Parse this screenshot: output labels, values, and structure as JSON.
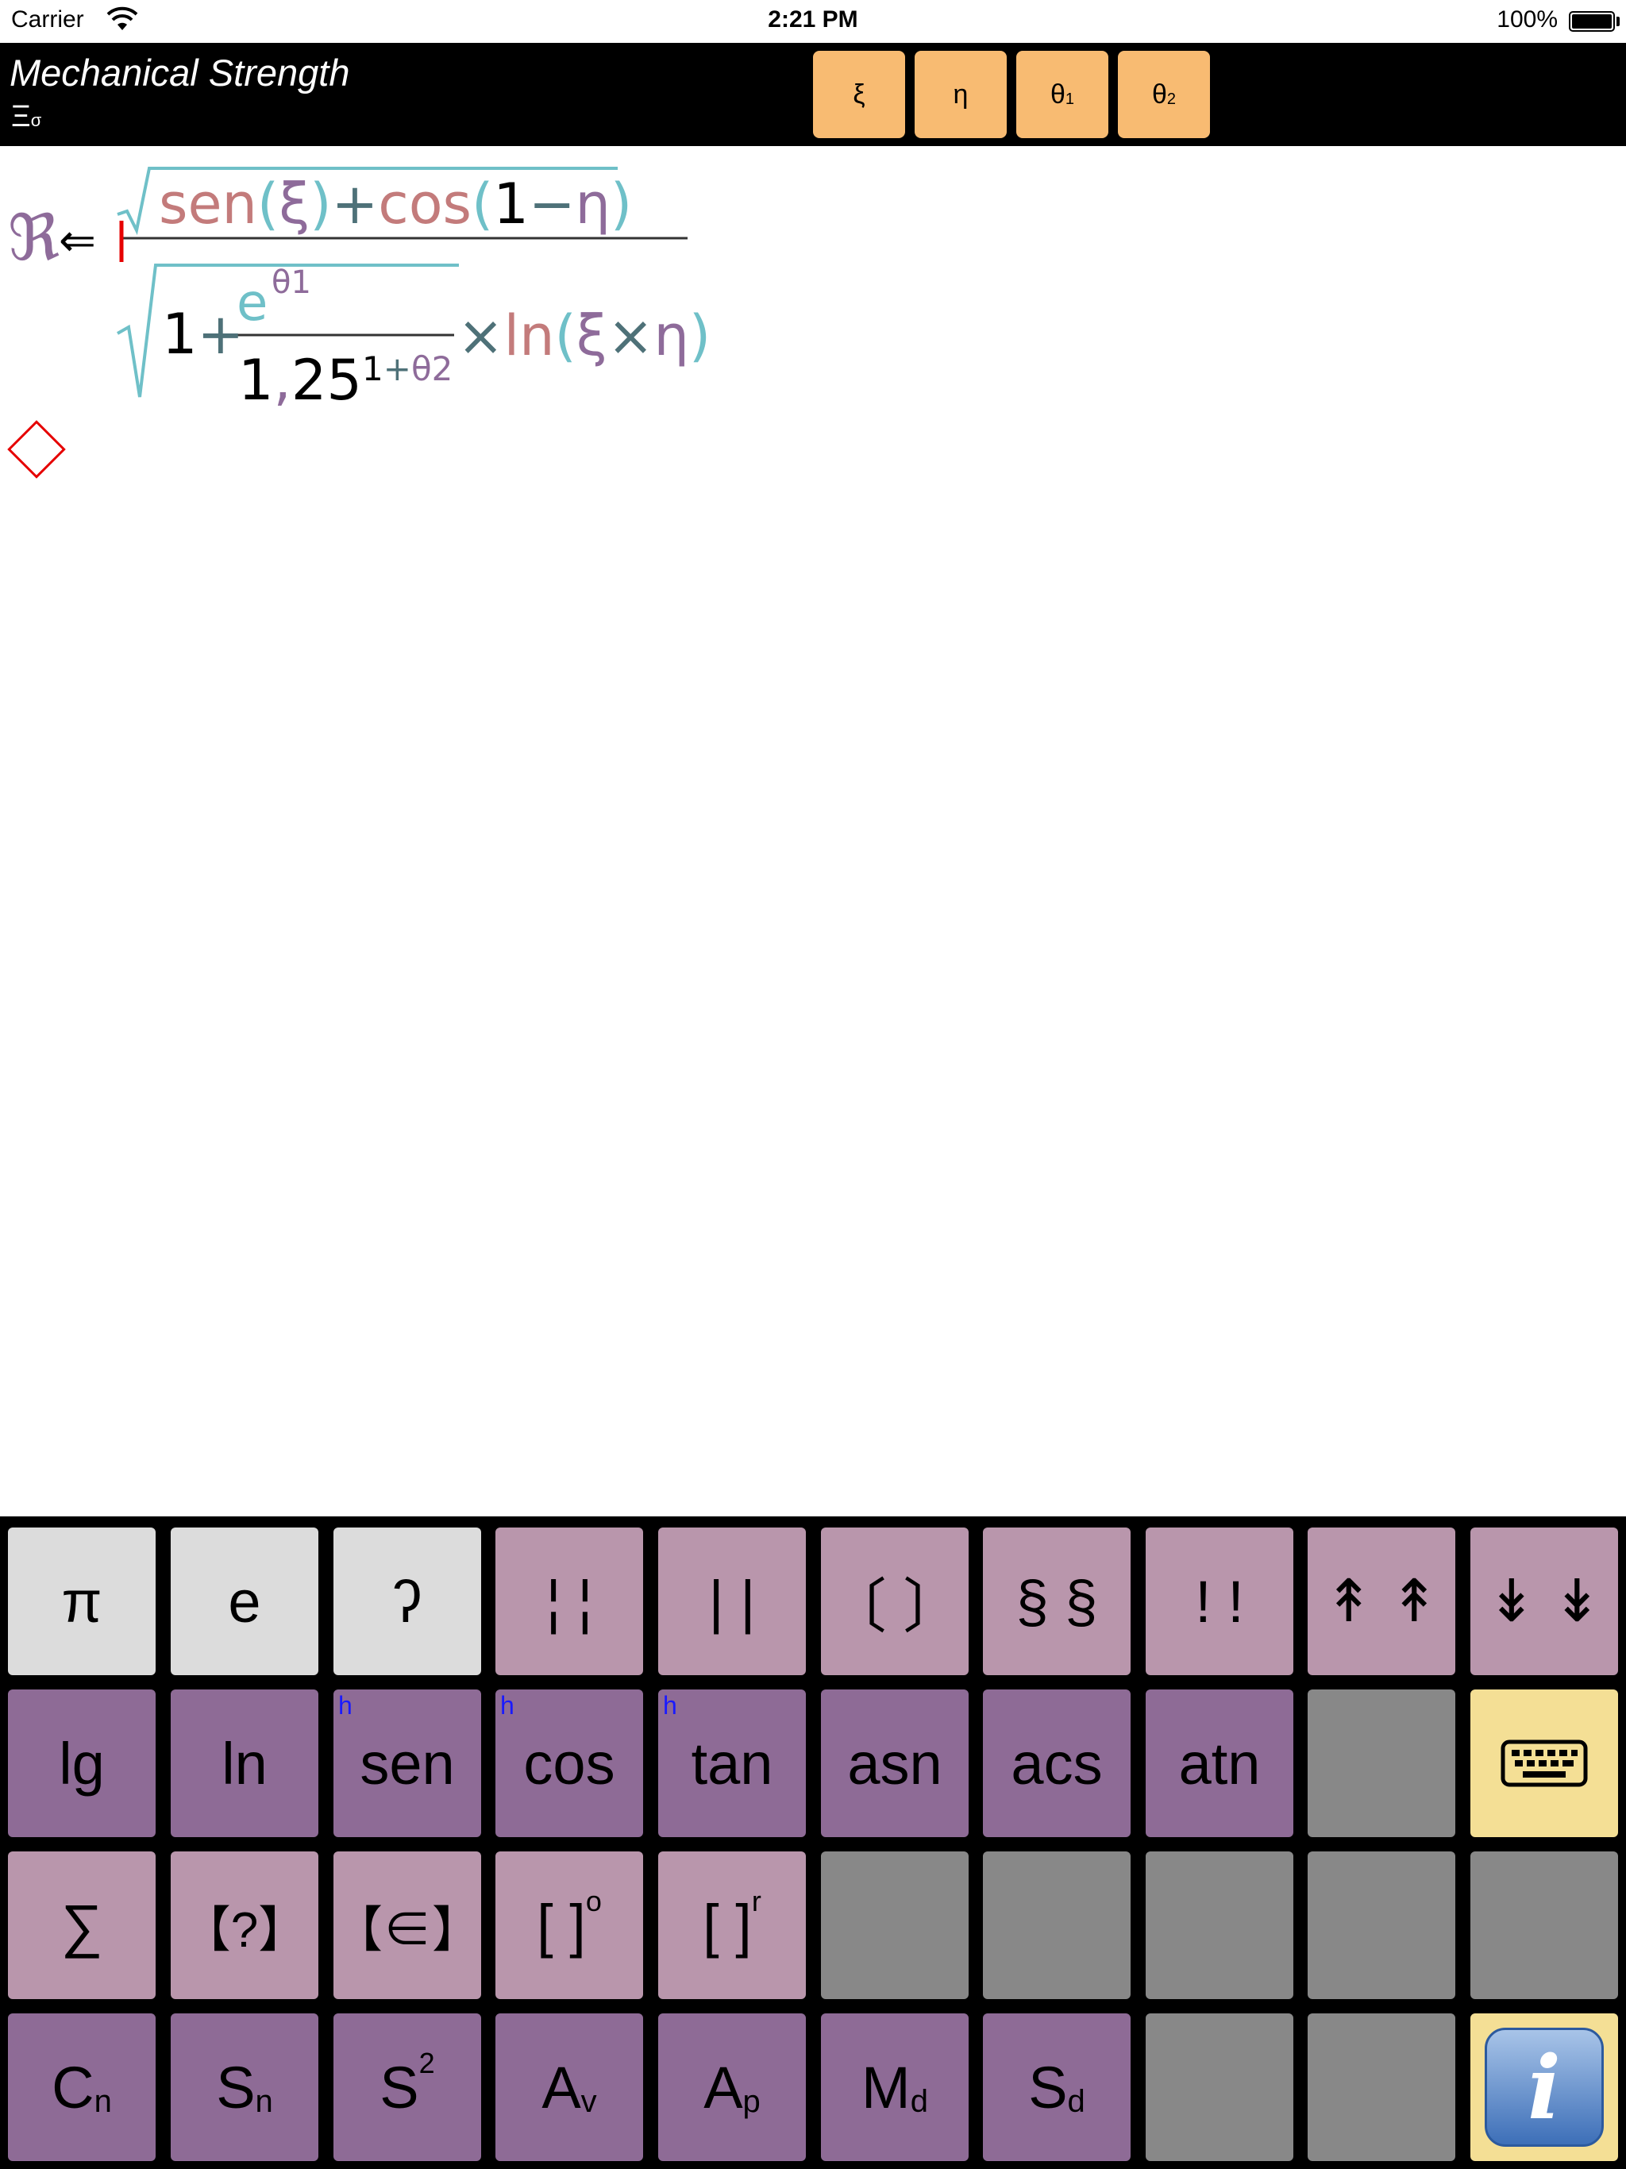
{
  "status_bar": {
    "carrier": "Carrier",
    "time": "2:21 PM",
    "battery": "100%"
  },
  "header": {
    "title": "Mechanical Strength",
    "menu_glyph": "Ξ",
    "menu_glyph_sub": "σ",
    "variables": [
      {
        "label": "ξ",
        "sub": ""
      },
      {
        "label": "η",
        "sub": ""
      },
      {
        "label": "θ",
        "sub": "1"
      },
      {
        "label": "θ",
        "sub": "2"
      }
    ]
  },
  "formula": {
    "lhs": "ℜ",
    "arrow": "⇐",
    "numerator": {
      "sen": "sen",
      "open1": "(",
      "xi": "ξ",
      "close1": ")",
      "plus": "+",
      "cos": "cos",
      "open2": "(",
      "one": "1",
      "minus": "−",
      "eta": "η",
      "close2": ")"
    },
    "denominator": {
      "one": "1",
      "plus": "+",
      "e": "e",
      "e_exp": "θ1",
      "base_int": "1",
      "comma": ",",
      "base_dec": "25",
      "exp_one": "1",
      "exp_plus": "+",
      "exp_theta": "θ2",
      "times": "×",
      "ln": "ln",
      "open": "(",
      "xi": "ξ",
      "times2": "×",
      "eta": "η",
      "close": ")"
    }
  },
  "keyboard": {
    "row1": [
      {
        "main": "π"
      },
      {
        "main": "e"
      },
      {
        "main": "ʔ"
      },
      {
        "main": "¦ ¦"
      },
      {
        "main": "| |"
      },
      {
        "main": "〔 〕"
      },
      {
        "main": "§ §"
      },
      {
        "main": "! !"
      },
      {
        "main": "↟ ↟"
      },
      {
        "main": "↡ ↡"
      }
    ],
    "row2": [
      {
        "main": "lg"
      },
      {
        "main": "ln"
      },
      {
        "main": "sen",
        "h": "h"
      },
      {
        "main": "cos",
        "h": "h"
      },
      {
        "main": "tan",
        "h": "h"
      },
      {
        "main": "asn"
      },
      {
        "main": "acs"
      },
      {
        "main": "atn"
      }
    ],
    "row3": [
      {
        "main": "∑"
      },
      {
        "main": "【?】"
      },
      {
        "main": "【∈】"
      },
      {
        "main": "[ ]",
        "sup": "o"
      },
      {
        "main": "[ ]",
        "sup": "r"
      }
    ],
    "row4": [
      {
        "main": "C",
        "sub": "n"
      },
      {
        "main": "S",
        "sub": "n"
      },
      {
        "main": "S",
        "sup": "2"
      },
      {
        "main": "A",
        "sub": "v"
      },
      {
        "main": "A",
        "sub": "p"
      },
      {
        "main": "M",
        "sub": "d"
      },
      {
        "main": "S",
        "sub": "d"
      }
    ],
    "info_glyph": "i",
    "keyboard_icon": "keyboard-icon"
  },
  "colors": {
    "header_bg": "#000000",
    "var_button": "#f8bb72",
    "key_light": "#dcdcdc",
    "key_pink": "#b996ac",
    "key_purple": "#8e6b96",
    "key_gray": "#888888",
    "key_yellow": "#f4df95",
    "formula_rose": "#c37b7b",
    "formula_teal": "#6fc0c8",
    "formula_plum": "#8e6b9a",
    "cursor": "#e60000"
  }
}
